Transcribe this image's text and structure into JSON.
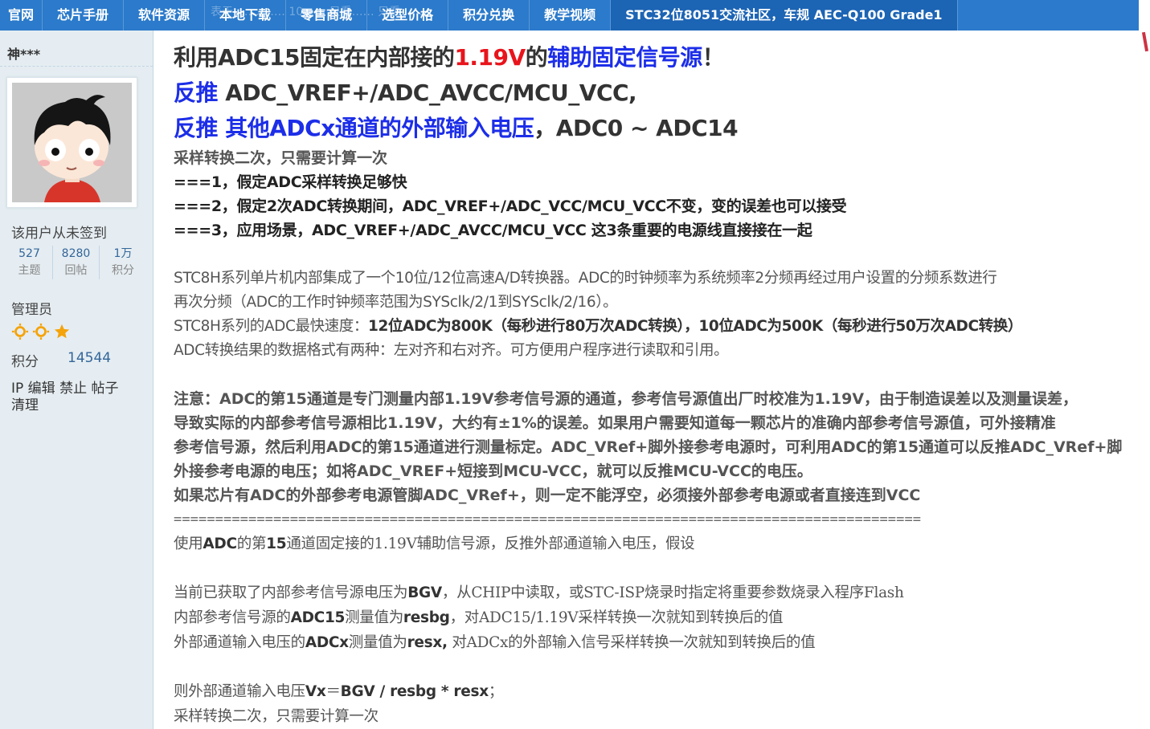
{
  "nav": {
    "items": [
      "官网",
      "芯片手册",
      "软件资源",
      "本地下载",
      "零售商城",
      "选型价格",
      "积分兑换",
      "教学视频",
      "STC32位8051交流社区，车规 AEC-Q100 Grade1"
    ],
    "ghost_text": "表于 ……   ……   10……   只看……   只看……"
  },
  "sidebar": {
    "username": "神***",
    "signin": "该用户从未签到",
    "stats": [
      {
        "num": "527",
        "label": "主题"
      },
      {
        "num": "8280",
        "label": "回帖"
      },
      {
        "num": "1万",
        "label": "积分"
      }
    ],
    "role": "管理员",
    "points_label": "积分",
    "points_value": "14544",
    "links_line1": "IP 编辑 禁止 帖子",
    "links_line2": "清理"
  },
  "post": {
    "h1": {
      "a": "利用ADC15固定在内部接的",
      "b": "1.19V",
      "c": "的",
      "d": "辅助固定信号源",
      "e": "！"
    },
    "h2": {
      "a": "反推",
      "b": " ADC_VREF+/ADC_AVCC/MCU_VCC,"
    },
    "h3": {
      "a": "反推 其他ADCx通道的外部输入电压",
      "b": "，ADC0 ~ ADC14"
    },
    "l1": "采样转换二次，只需要计算一次",
    "l2": "===1，假定ADC采样转换足够快",
    "l3": "===2，假定2次ADC转换期间，ADC_VREF+/ADC_VCC/MCU_VCC不变，变的误差也可以接受",
    "l4": "===3，应用场景，ADC_VREF+/ADC_AVCC/MCU_VCC 这3条重要的电源线直接接在一起",
    "p1a": "STC8H系列单片机内部集成了一个10位/12位高速A/D转换器。ADC的时钟频率为系统频率2分频再经过用户设置的分频系数进行",
    "p1b": "再次分频（ADC的工作时钟频率范围为SYSclk/2/1到SYSclk/2/16）。",
    "p1c_a": "STC8H系列的ADC最快速度：",
    "p1c_b": "12位ADC为800K（每秒进行80万次ADC转换），10位ADC为500K（每秒进行50万次ADC转换）",
    "p1d": "ADC转换结果的数据格式有两种：左对齐和右对齐。可方便用户程序进行读取和引用。",
    "n1": "注意：ADC的第15通道是专门测量内部1.19V参考信号源的通道，参考信号源值出厂时校准为1.19V，由于制造误差以及测量误差，",
    "n2": "导致实际的内部参考信号源相比1.19V，大约有±1%的误差。如果用户需要知道每一颗芯片的准确内部参考信号源值，可外接精准",
    "n3": "参考信号源，然后利用ADC的第15通道进行测量标定。ADC_VRef+脚外接参考电源时，可利用ADC的第15通道可以反推ADC_VRef+脚",
    "n4": "外接参考电源的电压；如将ADC_VREF+短接到MCU-VCC，就可以反推MCU-VCC的电压。",
    "n5": "如果芯片有ADC的外部参考电源管脚ADC_VRef+，则一定不能浮空，必须接外部参考电源或者直接连到VCC",
    "divider": "==========================================================================================",
    "s1a": "使用",
    "s1b": "ADC",
    "s1c": "的第",
    "s1d": "15",
    "s1e": "通道固定接的1.19V辅助信号源，反推外部通道输入电压，假设",
    "s2a": "当前已获取了内部参考信号源电压为",
    "s2b": "BGV",
    "s2c": "，从CHIP中读取，或STC-ISP烧录时指定将重要参数烧录入程序Flash",
    "s3a": "内部参考信号源的",
    "s3b": "ADC15",
    "s3c": "测量值为",
    "s3d": "resbg",
    "s3e": "，对ADC15/1.19V采样转换一次就知到转换后的值",
    "s4a": "外部通道输入电压的",
    "s4b": "ADCx",
    "s4c": "测量值为",
    "s4d": "resx,",
    "s4e": " 对ADCx的外部输入信号采样转换一次就知到转换后的值",
    "s5a": "则外部通道输入电压",
    "s5b": "Vx",
    "s5c": "＝",
    "s5d": "BGV / resbg * resx",
    "s5e": "；",
    "s6": "采样转换二次，只需要计算一次"
  }
}
